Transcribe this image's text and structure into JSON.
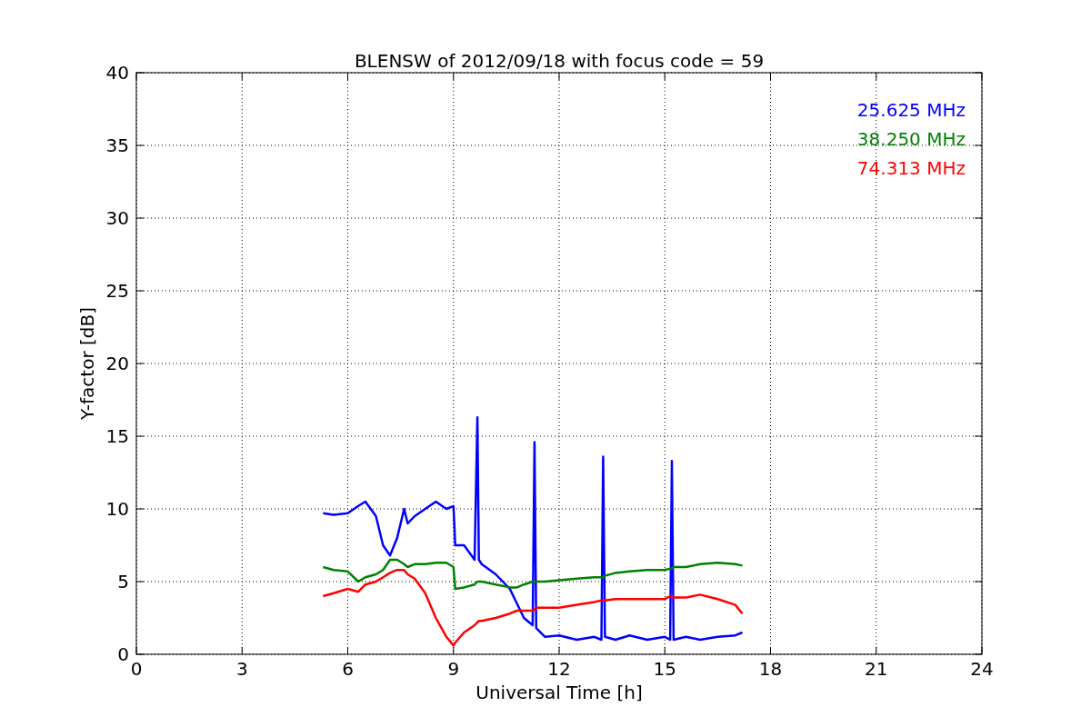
{
  "chart_data": {
    "type": "line",
    "title": "BLENSW of 2012/09/18 with focus code = 59",
    "xlabel": "Universal Time [h]",
    "ylabel": "Y-factor [dB]",
    "x": [
      5.3,
      5.6,
      6.0,
      6.3,
      6.5,
      6.8,
      7.0,
      7.2,
      7.4,
      7.6,
      7.7,
      7.9,
      8.2,
      8.5,
      8.8,
      9.0,
      9.05,
      9.3,
      9.6,
      9.68,
      9.72,
      9.8,
      10.2,
      10.6,
      10.8,
      11.0,
      11.25,
      11.3,
      11.35,
      11.6,
      12.0,
      12.5,
      13.0,
      13.2,
      13.25,
      13.3,
      13.6,
      14.0,
      14.5,
      15.0,
      15.15,
      15.2,
      15.25,
      15.6,
      16.0,
      16.5,
      17.0,
      17.2
    ],
    "series": [
      {
        "name": "25.625 MHz",
        "color": "#0000ff",
        "values": [
          9.7,
          9.6,
          9.7,
          10.2,
          10.5,
          9.5,
          7.5,
          6.8,
          8.0,
          10.0,
          9.0,
          9.5,
          10.0,
          10.5,
          10.0,
          10.2,
          7.5,
          7.5,
          6.5,
          16.3,
          6.5,
          6.2,
          5.5,
          4.5,
          3.5,
          2.5,
          2.0,
          14.6,
          1.8,
          1.2,
          1.3,
          1.0,
          1.2,
          1.0,
          13.6,
          1.2,
          1.0,
          1.3,
          1.0,
          1.2,
          1.0,
          13.3,
          1.0,
          1.2,
          1.0,
          1.2,
          1.3,
          1.5
        ]
      },
      {
        "name": "38.250 MHz",
        "color": "#008000",
        "values": [
          6.0,
          5.8,
          5.7,
          5.0,
          5.3,
          5.5,
          5.8,
          6.5,
          6.5,
          6.2,
          6.0,
          6.2,
          6.2,
          6.3,
          6.3,
          6.0,
          4.5,
          4.6,
          4.8,
          5.0,
          5.0,
          5.0,
          4.8,
          4.6,
          4.6,
          4.8,
          5.0,
          5.0,
          5.0,
          5.0,
          5.1,
          5.2,
          5.3,
          5.3,
          5.3,
          5.4,
          5.6,
          5.7,
          5.8,
          5.8,
          5.9,
          5.9,
          6.0,
          6.0,
          6.2,
          6.3,
          6.2,
          6.1
        ]
      },
      {
        "name": "74.313 MHz",
        "color": "#ff0000",
        "values": [
          4.0,
          4.2,
          4.5,
          4.3,
          4.8,
          5.0,
          5.3,
          5.6,
          5.8,
          5.8,
          5.5,
          5.2,
          4.2,
          2.5,
          1.2,
          0.6,
          0.8,
          1.5,
          2.0,
          2.2,
          2.3,
          2.3,
          2.5,
          2.8,
          3.0,
          3.0,
          3.0,
          3.1,
          3.2,
          3.2,
          3.2,
          3.4,
          3.6,
          3.7,
          3.7,
          3.7,
          3.8,
          3.8,
          3.8,
          3.8,
          4.0,
          4.0,
          3.9,
          3.9,
          4.1,
          3.8,
          3.4,
          2.8
        ]
      }
    ],
    "xlim": [
      0,
      24
    ],
    "ylim": [
      0,
      40
    ],
    "xticks": [
      0,
      3,
      6,
      9,
      12,
      15,
      18,
      21,
      24
    ],
    "yticks": [
      0,
      5,
      10,
      15,
      20,
      25,
      30,
      35,
      40
    ],
    "grid": true
  }
}
